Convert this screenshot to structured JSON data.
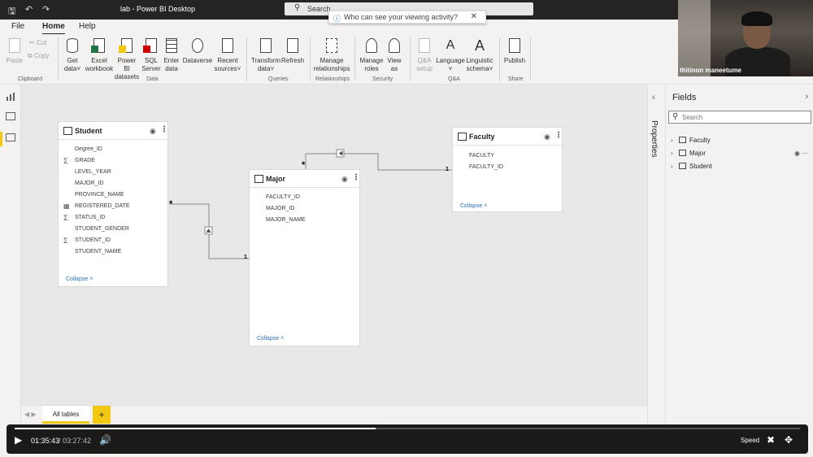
{
  "window": {
    "title": "lab - Power BI Desktop",
    "search_label": "Search",
    "tooltip": "Who can see your viewing activity?"
  },
  "webcam": {
    "name": "thitinon maneetume"
  },
  "menu": {
    "tabs": [
      "File",
      "Home",
      "Help"
    ],
    "active": "Home"
  },
  "ribbon": {
    "clipboard": {
      "paste": "Paste",
      "cut": "Cut",
      "copy": "Copy",
      "group": "Clipboard"
    },
    "data": {
      "get_data": [
        "Get",
        "data"
      ],
      "excel": [
        "Excel",
        "workbook"
      ],
      "pbi_datasets": [
        "Power BI",
        "datasets"
      ],
      "sql": [
        "SQL",
        "Server"
      ],
      "enter": [
        "Enter",
        "data"
      ],
      "dataverse": "Dataverse",
      "recent": [
        "Recent",
        "sources"
      ],
      "group": "Data"
    },
    "queries": {
      "transform": [
        "Transform",
        "data"
      ],
      "refresh": "Refresh",
      "group": "Queries"
    },
    "relationships": {
      "manage": [
        "Manage",
        "relationships"
      ],
      "group": "Relationships"
    },
    "security": {
      "roles": [
        "Manage",
        "roles"
      ],
      "view_as": [
        "View",
        "as"
      ],
      "group": "Security"
    },
    "qa": {
      "setup": [
        "Q&A",
        "setup"
      ],
      "language": "Language",
      "schema": [
        "Linguistic",
        "schema"
      ],
      "group": "Q&A"
    },
    "share": {
      "publish": "Publish",
      "group": "Share"
    }
  },
  "tables": {
    "student": {
      "name": "Student",
      "fields": [
        "Degree_ID",
        "GRADE",
        "LEVEL_YEAR",
        "MAJOR_ID",
        "PROVINCE_NAME",
        "REGISTERED_DATE",
        "STATUS_ID",
        "STUDENT_GENDER",
        "STUDENT_ID",
        "STUDENT_NAME"
      ],
      "collapse": "Collapse"
    },
    "major": {
      "name": "Major",
      "fields": [
        "FACULTY_ID",
        "MAJOR_ID",
        "MAJOR_NAME"
      ],
      "collapse": "Collapse"
    },
    "faculty": {
      "name": "Faculty",
      "fields": [
        "FACULTY",
        "FACULTY_ID"
      ],
      "collapse": "Collapse"
    }
  },
  "relationships": {
    "many": "*",
    "one": "1"
  },
  "bottom": {
    "tab": "All tables",
    "add": "+"
  },
  "panes": {
    "properties": "Properties",
    "fields": {
      "title": "Fields",
      "search_placeholder": "Search",
      "items": [
        "Faculty",
        "Major",
        "Student"
      ]
    }
  },
  "video": {
    "current": "01:35:43",
    "total": "/ 03:27:42",
    "progress": 0.46,
    "speed": "Speed"
  }
}
